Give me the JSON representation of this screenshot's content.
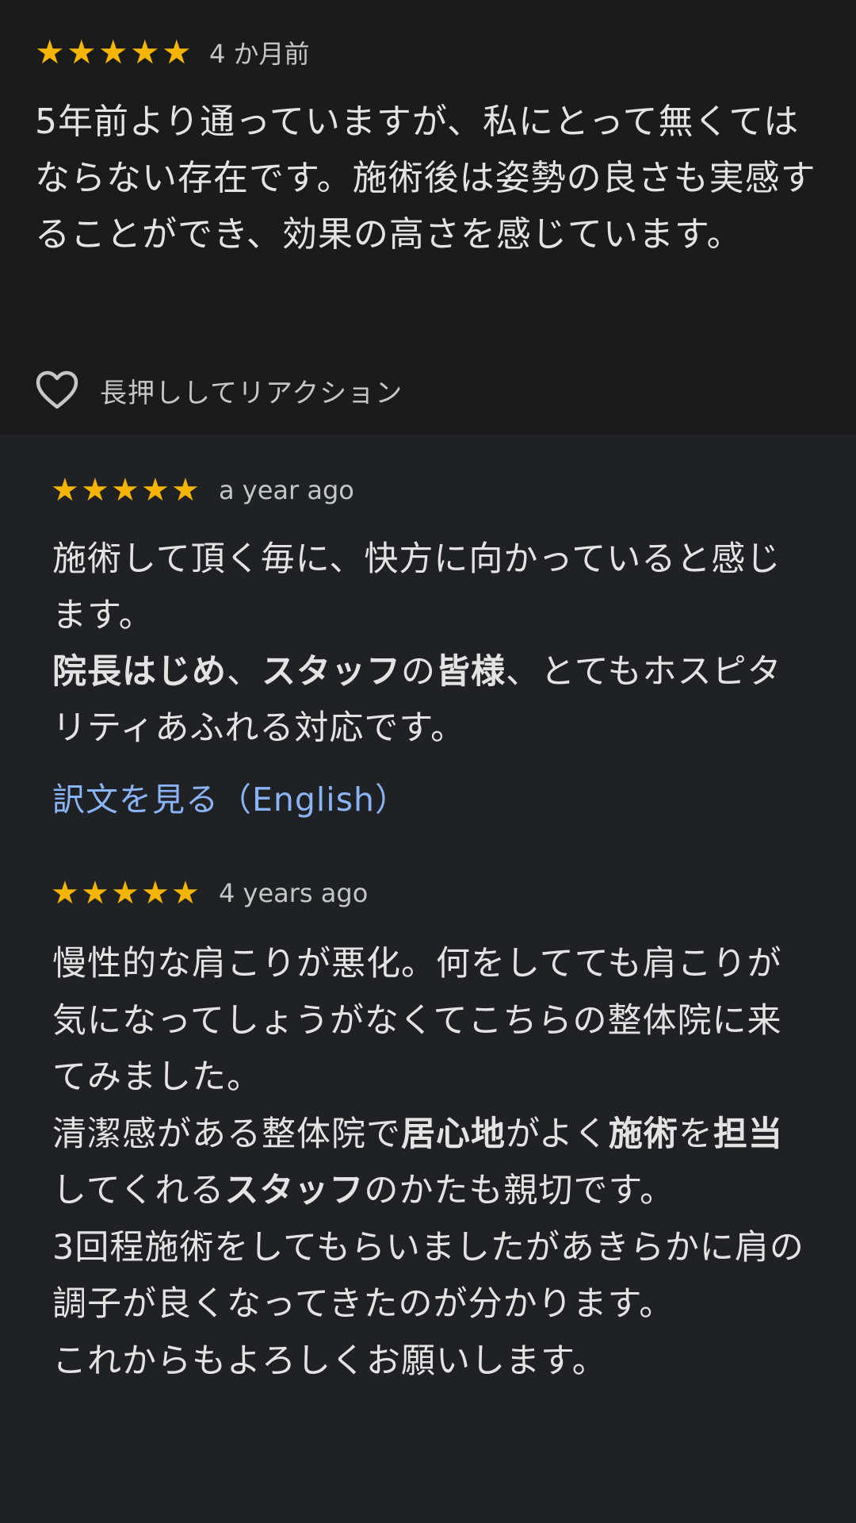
{
  "reviews": [
    {
      "rating": 5,
      "date": "4 か月前",
      "text": "5年前より通っていますが、私にとって無くてはならない存在です。施術後は姿勢の良さも実感することができ、効果の高さを感じています。",
      "reaction_label": "長押ししてリアクション"
    },
    {
      "rating": 5,
      "date": "a year ago",
      "line1": "施術して頂く毎に、快方に向かっていると感じます。",
      "line2": {
        "b1": "院長はじめ",
        "t1": "、",
        "b2": "スタッフ",
        "t2": "の",
        "b3": "皆様",
        "t3": "、とてもホスピタリティあふれる対応です。"
      },
      "translate_link": "訳文を見る（English）"
    },
    {
      "rating": 5,
      "date": "4 years ago",
      "para1": "慢性的な肩こりが悪化。何をしてても肩こりが気になってしょうがなくてこちらの整体院に来てみました。",
      "para2": {
        "t1": "清潔感がある整体院で",
        "b1": "居心地",
        "t2": "がよく",
        "b2": "施術",
        "t3": "を",
        "b3": "担当",
        "t4": "してくれる",
        "b4": "スタッフ",
        "t5": "のかたも親切です。"
      },
      "para3": "3回程施術をしてもらいましたがあきらかに肩の調子が良くなってきたのが分かります。",
      "para4": "これからもよろしくお願いします。"
    }
  ],
  "icons": {
    "star": "★",
    "heart": "heart-outline-icon"
  },
  "colors": {
    "star": "#f4b400",
    "link": "#8ab4f8",
    "background": "#202124"
  }
}
